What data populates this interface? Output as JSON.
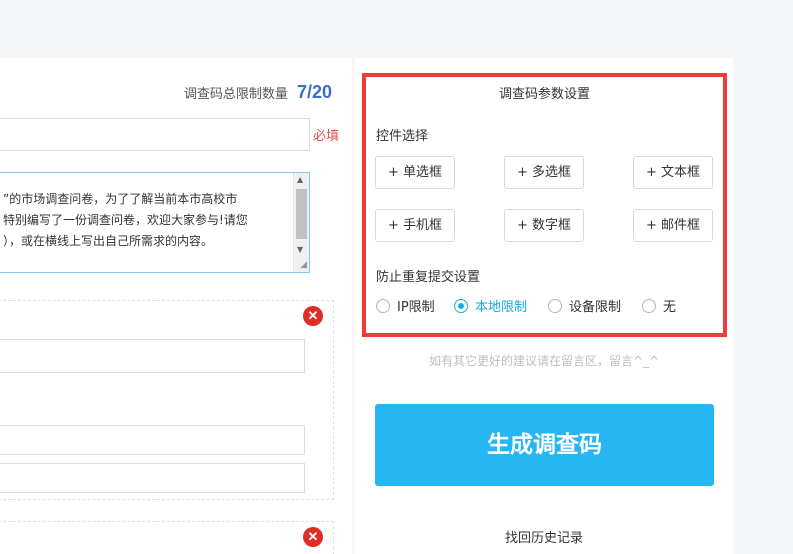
{
  "survey": {
    "limit_label": "调查码总限制数量",
    "limit_count": "7/20",
    "required_mark": "必填",
    "description_lines": [
      "”的市场调查问卷，为了了解当前本市高校市",
      "特别编写了一份调查问卷，欢迎大家参与!请您",
      "），或在横线上写出自己所需求的内容。"
    ],
    "delete_symbol": "✕"
  },
  "settings": {
    "title": "调查码参数设置",
    "control_label": "控件选择",
    "controls": [
      "+ 单选框",
      "+ 多选框",
      "+ 文本框",
      "+ 手机框",
      "+ 数字框",
      "+ 邮件框"
    ],
    "duplicate_label": "防止重复提交设置",
    "duplicate_options": [
      "IP限制",
      "本地限制",
      "设备限制",
      "无"
    ],
    "selected_option": "本地限制",
    "accent_color": "#1aa8e6",
    "highlight_color": "#f13b3b"
  },
  "suggestion": "如有其它更好的建议请在留言区，留言^_^",
  "generate_label": "生成调查码",
  "generate_color": "#25b6f3",
  "history_label": "找回历史记录",
  "icons": {
    "scroll_up": "up-arrow-icon",
    "scroll_down": "down-arrow-icon",
    "delete": "close-circle-icon"
  }
}
